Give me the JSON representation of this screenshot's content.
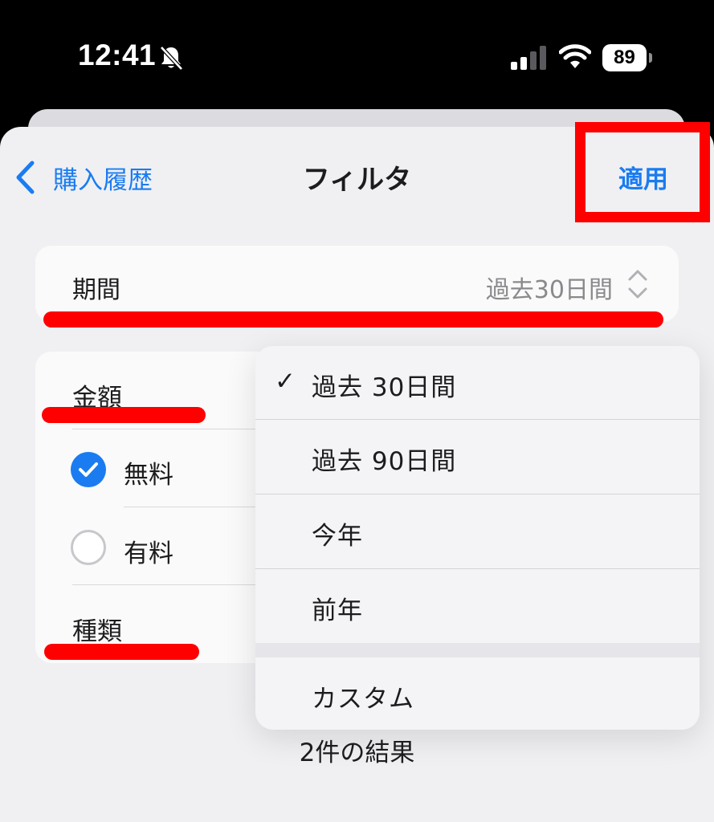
{
  "status_bar": {
    "time": "12:41",
    "battery": "89",
    "icons": [
      "bell-slash-icon",
      "signal-icon",
      "wifi-icon",
      "battery-icon"
    ]
  },
  "nav": {
    "back_label": "購入履歴",
    "title": "フィルタ",
    "apply_label": "適用"
  },
  "period": {
    "label": "期間",
    "value": "過去30日間"
  },
  "filters": {
    "amount_label": "金額",
    "options": [
      {
        "label": "無料",
        "checked": true
      },
      {
        "label": "有料",
        "checked": false
      }
    ],
    "type_label": "種類"
  },
  "menu": {
    "items": [
      {
        "label": "過去 30日間",
        "selected": true
      },
      {
        "label": "過去 90日間",
        "selected": false
      },
      {
        "label": "今年",
        "selected": false
      },
      {
        "label": "前年",
        "selected": false
      },
      {
        "label": "カスタム",
        "selected": false
      }
    ],
    "check_mark": "✓"
  },
  "results": "2件の結果",
  "colors": {
    "accent": "#1a7cf0",
    "annotation": "#ff0000"
  }
}
